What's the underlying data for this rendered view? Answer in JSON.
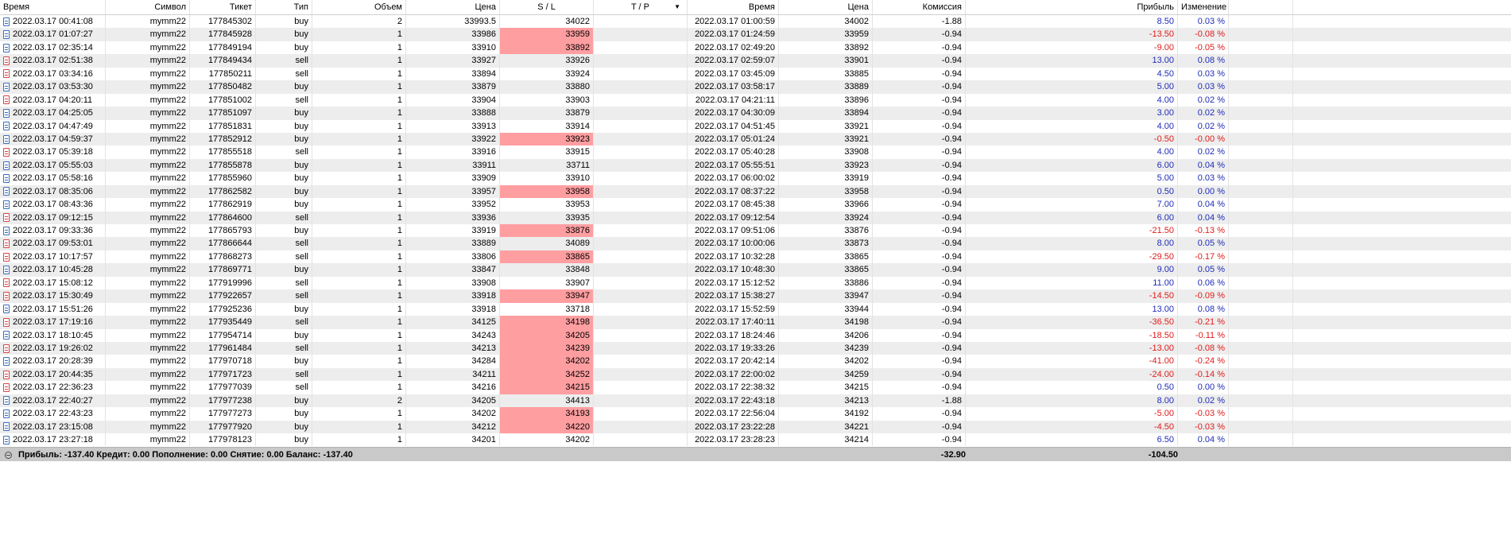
{
  "table": {
    "headers": [
      "Время",
      "Символ",
      "Тикет",
      "Тип",
      "Объем",
      "Цена",
      "S / L",
      "T / P",
      "Время",
      "Цена",
      "Комиссия",
      "Прибыль",
      "Изменение"
    ],
    "sorted_column": "T / P",
    "rows": [
      {
        "open_time": "2022.03.17 00:41:08",
        "symbol": "mymm22",
        "ticket": "177845302",
        "type": "buy",
        "volume": "2",
        "open_price": "33993.5",
        "sl": "34022",
        "tp": "",
        "close_time": "2022.03.17 01:00:59",
        "close_price": "34002",
        "commission": "-1.88",
        "profit": "8.50",
        "change": "0.03 %",
        "sl_hit": false,
        "profit_sign": "pos"
      },
      {
        "open_time": "2022.03.17 01:07:27",
        "symbol": "mymm22",
        "ticket": "177845928",
        "type": "buy",
        "volume": "1",
        "open_price": "33986",
        "sl": "33959",
        "tp": "",
        "close_time": "2022.03.17 01:24:59",
        "close_price": "33959",
        "commission": "-0.94",
        "profit": "-13.50",
        "change": "-0.08 %",
        "sl_hit": true,
        "profit_sign": "neg"
      },
      {
        "open_time": "2022.03.17 02:35:14",
        "symbol": "mymm22",
        "ticket": "177849194",
        "type": "buy",
        "volume": "1",
        "open_price": "33910",
        "sl": "33892",
        "tp": "",
        "close_time": "2022.03.17 02:49:20",
        "close_price": "33892",
        "commission": "-0.94",
        "profit": "-9.00",
        "change": "-0.05 %",
        "sl_hit": true,
        "profit_sign": "neg"
      },
      {
        "open_time": "2022.03.17 02:51:38",
        "symbol": "mymm22",
        "ticket": "177849434",
        "type": "sell",
        "volume": "1",
        "open_price": "33927",
        "sl": "33926",
        "tp": "",
        "close_time": "2022.03.17 02:59:07",
        "close_price": "33901",
        "commission": "-0.94",
        "profit": "13.00",
        "change": "0.08 %",
        "sl_hit": false,
        "profit_sign": "pos"
      },
      {
        "open_time": "2022.03.17 03:34:16",
        "symbol": "mymm22",
        "ticket": "177850211",
        "type": "sell",
        "volume": "1",
        "open_price": "33894",
        "sl": "33924",
        "tp": "",
        "close_time": "2022.03.17 03:45:09",
        "close_price": "33885",
        "commission": "-0.94",
        "profit": "4.50",
        "change": "0.03 %",
        "sl_hit": false,
        "profit_sign": "pos"
      },
      {
        "open_time": "2022.03.17 03:53:30",
        "symbol": "mymm22",
        "ticket": "177850482",
        "type": "buy",
        "volume": "1",
        "open_price": "33879",
        "sl": "33880",
        "tp": "",
        "close_time": "2022.03.17 03:58:17",
        "close_price": "33889",
        "commission": "-0.94",
        "profit": "5.00",
        "change": "0.03 %",
        "sl_hit": false,
        "profit_sign": "pos"
      },
      {
        "open_time": "2022.03.17 04:20:11",
        "symbol": "mymm22",
        "ticket": "177851002",
        "type": "sell",
        "volume": "1",
        "open_price": "33904",
        "sl": "33903",
        "tp": "",
        "close_time": "2022.03.17 04:21:11",
        "close_price": "33896",
        "commission": "-0.94",
        "profit": "4.00",
        "change": "0.02 %",
        "sl_hit": false,
        "profit_sign": "pos"
      },
      {
        "open_time": "2022.03.17 04:25:05",
        "symbol": "mymm22",
        "ticket": "177851097",
        "type": "buy",
        "volume": "1",
        "open_price": "33888",
        "sl": "33879",
        "tp": "",
        "close_time": "2022.03.17 04:30:09",
        "close_price": "33894",
        "commission": "-0.94",
        "profit": "3.00",
        "change": "0.02 %",
        "sl_hit": false,
        "profit_sign": "pos"
      },
      {
        "open_time": "2022.03.17 04:47:49",
        "symbol": "mymm22",
        "ticket": "177851831",
        "type": "buy",
        "volume": "1",
        "open_price": "33913",
        "sl": "33914",
        "tp": "",
        "close_time": "2022.03.17 04:51:45",
        "close_price": "33921",
        "commission": "-0.94",
        "profit": "4.00",
        "change": "0.02 %",
        "sl_hit": false,
        "profit_sign": "pos"
      },
      {
        "open_time": "2022.03.17 04:59:37",
        "symbol": "mymm22",
        "ticket": "177852912",
        "type": "buy",
        "volume": "1",
        "open_price": "33922",
        "sl": "33923",
        "tp": "",
        "close_time": "2022.03.17 05:01:24",
        "close_price": "33921",
        "commission": "-0.94",
        "profit": "-0.50",
        "change": "-0.00 %",
        "sl_hit": true,
        "profit_sign": "neg"
      },
      {
        "open_time": "2022.03.17 05:39:18",
        "symbol": "mymm22",
        "ticket": "177855518",
        "type": "sell",
        "volume": "1",
        "open_price": "33916",
        "sl": "33915",
        "tp": "",
        "close_time": "2022.03.17 05:40:28",
        "close_price": "33908",
        "commission": "-0.94",
        "profit": "4.00",
        "change": "0.02 %",
        "sl_hit": false,
        "profit_sign": "pos"
      },
      {
        "open_time": "2022.03.17 05:55:03",
        "symbol": "mymm22",
        "ticket": "177855878",
        "type": "buy",
        "volume": "1",
        "open_price": "33911",
        "sl": "33711",
        "tp": "",
        "close_time": "2022.03.17 05:55:51",
        "close_price": "33923",
        "commission": "-0.94",
        "profit": "6.00",
        "change": "0.04 %",
        "sl_hit": false,
        "profit_sign": "pos"
      },
      {
        "open_time": "2022.03.17 05:58:16",
        "symbol": "mymm22",
        "ticket": "177855960",
        "type": "buy",
        "volume": "1",
        "open_price": "33909",
        "sl": "33910",
        "tp": "",
        "close_time": "2022.03.17 06:00:02",
        "close_price": "33919",
        "commission": "-0.94",
        "profit": "5.00",
        "change": "0.03 %",
        "sl_hit": false,
        "profit_sign": "pos"
      },
      {
        "open_time": "2022.03.17 08:35:06",
        "symbol": "mymm22",
        "ticket": "177862582",
        "type": "buy",
        "volume": "1",
        "open_price": "33957",
        "sl": "33958",
        "tp": "",
        "close_time": "2022.03.17 08:37:22",
        "close_price": "33958",
        "commission": "-0.94",
        "profit": "0.50",
        "change": "0.00 %",
        "sl_hit": true,
        "profit_sign": "pos"
      },
      {
        "open_time": "2022.03.17 08:43:36",
        "symbol": "mymm22",
        "ticket": "177862919",
        "type": "buy",
        "volume": "1",
        "open_price": "33952",
        "sl": "33953",
        "tp": "",
        "close_time": "2022.03.17 08:45:38",
        "close_price": "33966",
        "commission": "-0.94",
        "profit": "7.00",
        "change": "0.04 %",
        "sl_hit": false,
        "profit_sign": "pos"
      },
      {
        "open_time": "2022.03.17 09:12:15",
        "symbol": "mymm22",
        "ticket": "177864600",
        "type": "sell",
        "volume": "1",
        "open_price": "33936",
        "sl": "33935",
        "tp": "",
        "close_time": "2022.03.17 09:12:54",
        "close_price": "33924",
        "commission": "-0.94",
        "profit": "6.00",
        "change": "0.04 %",
        "sl_hit": false,
        "profit_sign": "pos"
      },
      {
        "open_time": "2022.03.17 09:33:36",
        "symbol": "mymm22",
        "ticket": "177865793",
        "type": "buy",
        "volume": "1",
        "open_price": "33919",
        "sl": "33876",
        "tp": "",
        "close_time": "2022.03.17 09:51:06",
        "close_price": "33876",
        "commission": "-0.94",
        "profit": "-21.50",
        "change": "-0.13 %",
        "sl_hit": true,
        "profit_sign": "neg"
      },
      {
        "open_time": "2022.03.17 09:53:01",
        "symbol": "mymm22",
        "ticket": "177866644",
        "type": "sell",
        "volume": "1",
        "open_price": "33889",
        "sl": "34089",
        "tp": "",
        "close_time": "2022.03.17 10:00:06",
        "close_price": "33873",
        "commission": "-0.94",
        "profit": "8.00",
        "change": "0.05 %",
        "sl_hit": false,
        "profit_sign": "pos"
      },
      {
        "open_time": "2022.03.17 10:17:57",
        "symbol": "mymm22",
        "ticket": "177868273",
        "type": "sell",
        "volume": "1",
        "open_price": "33806",
        "sl": "33865",
        "tp": "",
        "close_time": "2022.03.17 10:32:28",
        "close_price": "33865",
        "commission": "-0.94",
        "profit": "-29.50",
        "change": "-0.17 %",
        "sl_hit": true,
        "profit_sign": "neg"
      },
      {
        "open_time": "2022.03.17 10:45:28",
        "symbol": "mymm22",
        "ticket": "177869771",
        "type": "buy",
        "volume": "1",
        "open_price": "33847",
        "sl": "33848",
        "tp": "",
        "close_time": "2022.03.17 10:48:30",
        "close_price": "33865",
        "commission": "-0.94",
        "profit": "9.00",
        "change": "0.05 %",
        "sl_hit": false,
        "profit_sign": "pos"
      },
      {
        "open_time": "2022.03.17 15:08:12",
        "symbol": "mymm22",
        "ticket": "177919996",
        "type": "sell",
        "volume": "1",
        "open_price": "33908",
        "sl": "33907",
        "tp": "",
        "close_time": "2022.03.17 15:12:52",
        "close_price": "33886",
        "commission": "-0.94",
        "profit": "11.00",
        "change": "0.06 %",
        "sl_hit": false,
        "profit_sign": "pos"
      },
      {
        "open_time": "2022.03.17 15:30:49",
        "symbol": "mymm22",
        "ticket": "177922657",
        "type": "sell",
        "volume": "1",
        "open_price": "33918",
        "sl": "33947",
        "tp": "",
        "close_time": "2022.03.17 15:38:27",
        "close_price": "33947",
        "commission": "-0.94",
        "profit": "-14.50",
        "change": "-0.09 %",
        "sl_hit": true,
        "profit_sign": "neg"
      },
      {
        "open_time": "2022.03.17 15:51:26",
        "symbol": "mymm22",
        "ticket": "177925236",
        "type": "buy",
        "volume": "1",
        "open_price": "33918",
        "sl": "33718",
        "tp": "",
        "close_time": "2022.03.17 15:52:59",
        "close_price": "33944",
        "commission": "-0.94",
        "profit": "13.00",
        "change": "0.08 %",
        "sl_hit": false,
        "profit_sign": "pos"
      },
      {
        "open_time": "2022.03.17 17:19:16",
        "symbol": "mymm22",
        "ticket": "177935449",
        "type": "sell",
        "volume": "1",
        "open_price": "34125",
        "sl": "34198",
        "tp": "",
        "close_time": "2022.03.17 17:40:11",
        "close_price": "34198",
        "commission": "-0.94",
        "profit": "-36.50",
        "change": "-0.21 %",
        "sl_hit": true,
        "profit_sign": "neg"
      },
      {
        "open_time": "2022.03.17 18:10:45",
        "symbol": "mymm22",
        "ticket": "177954714",
        "type": "buy",
        "volume": "1",
        "open_price": "34243",
        "sl": "34205",
        "tp": "",
        "close_time": "2022.03.17 18:24:46",
        "close_price": "34206",
        "commission": "-0.94",
        "profit": "-18.50",
        "change": "-0.11 %",
        "sl_hit": true,
        "profit_sign": "neg"
      },
      {
        "open_time": "2022.03.17 19:26:02",
        "symbol": "mymm22",
        "ticket": "177961484",
        "type": "sell",
        "volume": "1",
        "open_price": "34213",
        "sl": "34239",
        "tp": "",
        "close_time": "2022.03.17 19:33:26",
        "close_price": "34239",
        "commission": "-0.94",
        "profit": "-13.00",
        "change": "-0.08 %",
        "sl_hit": true,
        "profit_sign": "neg"
      },
      {
        "open_time": "2022.03.17 20:28:39",
        "symbol": "mymm22",
        "ticket": "177970718",
        "type": "buy",
        "volume": "1",
        "open_price": "34284",
        "sl": "34202",
        "tp": "",
        "close_time": "2022.03.17 20:42:14",
        "close_price": "34202",
        "commission": "-0.94",
        "profit": "-41.00",
        "change": "-0.24 %",
        "sl_hit": true,
        "profit_sign": "neg"
      },
      {
        "open_time": "2022.03.17 20:44:35",
        "symbol": "mymm22",
        "ticket": "177971723",
        "type": "sell",
        "volume": "1",
        "open_price": "34211",
        "sl": "34252",
        "tp": "",
        "close_time": "2022.03.17 22:00:02",
        "close_price": "34259",
        "commission": "-0.94",
        "profit": "-24.00",
        "change": "-0.14 %",
        "sl_hit": true,
        "profit_sign": "neg"
      },
      {
        "open_time": "2022.03.17 22:36:23",
        "symbol": "mymm22",
        "ticket": "177977039",
        "type": "sell",
        "volume": "1",
        "open_price": "34216",
        "sl": "34215",
        "tp": "",
        "close_time": "2022.03.17 22:38:32",
        "close_price": "34215",
        "commission": "-0.94",
        "profit": "0.50",
        "change": "0.00 %",
        "sl_hit": true,
        "profit_sign": "pos"
      },
      {
        "open_time": "2022.03.17 22:40:27",
        "symbol": "mymm22",
        "ticket": "177977238",
        "type": "buy",
        "volume": "2",
        "open_price": "34205",
        "sl": "34413",
        "tp": "",
        "close_time": "2022.03.17 22:43:18",
        "close_price": "34213",
        "commission": "-1.88",
        "profit": "8.00",
        "change": "0.02 %",
        "sl_hit": false,
        "profit_sign": "pos"
      },
      {
        "open_time": "2022.03.17 22:43:23",
        "symbol": "mymm22",
        "ticket": "177977273",
        "type": "buy",
        "volume": "1",
        "open_price": "34202",
        "sl": "34193",
        "tp": "",
        "close_time": "2022.03.17 22:56:04",
        "close_price": "34192",
        "commission": "-0.94",
        "profit": "-5.00",
        "change": "-0.03 %",
        "sl_hit": true,
        "profit_sign": "neg"
      },
      {
        "open_time": "2022.03.17 23:15:08",
        "symbol": "mymm22",
        "ticket": "177977920",
        "type": "buy",
        "volume": "1",
        "open_price": "34212",
        "sl": "34220",
        "tp": "",
        "close_time": "2022.03.17 23:22:28",
        "close_price": "34221",
        "commission": "-0.94",
        "profit": "-4.50",
        "change": "-0.03 %",
        "sl_hit": true,
        "profit_sign": "neg"
      },
      {
        "open_time": "2022.03.17 23:27:18",
        "symbol": "mymm22",
        "ticket": "177978123",
        "type": "buy",
        "volume": "1",
        "open_price": "34201",
        "sl": "34202",
        "tp": "",
        "close_time": "2022.03.17 23:28:23",
        "close_price": "34214",
        "commission": "-0.94",
        "profit": "6.50",
        "change": "0.04 %",
        "sl_hit": false,
        "profit_sign": "pos"
      }
    ]
  },
  "footer": {
    "summary": "Прибыль: -137.40  Кредит: 0.00  Пополнение: 0.00  Снятие: 0.00  Баланс: -137.40",
    "commission_total": "-32.90",
    "profit_total": "-104.50"
  },
  "colors": {
    "sl_hit_bg": "#ff9ea1",
    "positive_profit": "#1f2db8",
    "negative_profit": "#e01b1b",
    "alternate_row_bg": "#ededed",
    "footer_bg": "#c9c9c9"
  },
  "icons": {
    "row_buy_icon": "document-buy-icon",
    "row_sell_icon": "document-sell-icon",
    "footer_icon": "collapse-icon",
    "sort_icon": "sort-down-icon"
  }
}
